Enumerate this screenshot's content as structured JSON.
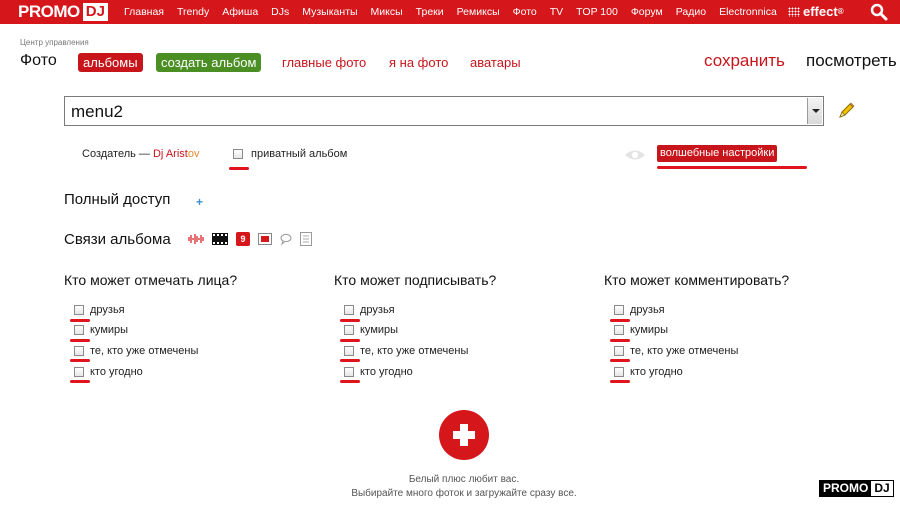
{
  "topnav": {
    "logo_promo": "PROMO",
    "logo_dj": "DJ",
    "items": [
      "Главная",
      "Trendy",
      "Афиша",
      "DJs",
      "Музыканты",
      "Миксы",
      "Треки",
      "Ремиксы",
      "Фото",
      "TV",
      "TOP 100",
      "Форум",
      "Радио",
      "Electronnica"
    ],
    "effect": "effect",
    "effect_mark": "®"
  },
  "header": {
    "breadcrumb": "Центр управления",
    "title": "Фото",
    "tab_albums": "альбомы",
    "tab_create": "создать альбом",
    "link_main_photos": "главные фото",
    "link_me_in_photo": "я на фото",
    "link_avatars": "аватары",
    "save": "сохранить",
    "view": "посмотреть"
  },
  "album_select": {
    "value": "menu2"
  },
  "creator": {
    "label": "Создатель —",
    "name_part1": "Dj Arist",
    "name_part2": "ov",
    "private_label": "приватный альбом",
    "magic_settings": "волшебные настройки"
  },
  "sections": {
    "full_access": "Полный доступ",
    "album_links": "Связи альбома",
    "links_badge": "9"
  },
  "permissions": [
    {
      "title": "Кто может отмечать лица?",
      "options": [
        "друзья",
        "кумиры",
        "те, кто уже отмечены",
        "кто угодно"
      ]
    },
    {
      "title": "Кто может подписывать?",
      "options": [
        "друзья",
        "кумиры",
        "те, кто уже отмечены",
        "кто угодно"
      ]
    },
    {
      "title": "Кто может комментировать?",
      "options": [
        "друзья",
        "кумиры",
        "те, кто уже отмечены",
        "кто угодно"
      ]
    }
  ],
  "upload": {
    "line1": "Белый плюс любит вас.",
    "line2": "Выбирайте много фоток и загружайте сразу все."
  },
  "watermark": {
    "a": "PROMO",
    "b": "DJ"
  },
  "colors": {
    "brand_red": "#d5161b",
    "green": "#4b8f24",
    "underline": "#e0141c"
  }
}
